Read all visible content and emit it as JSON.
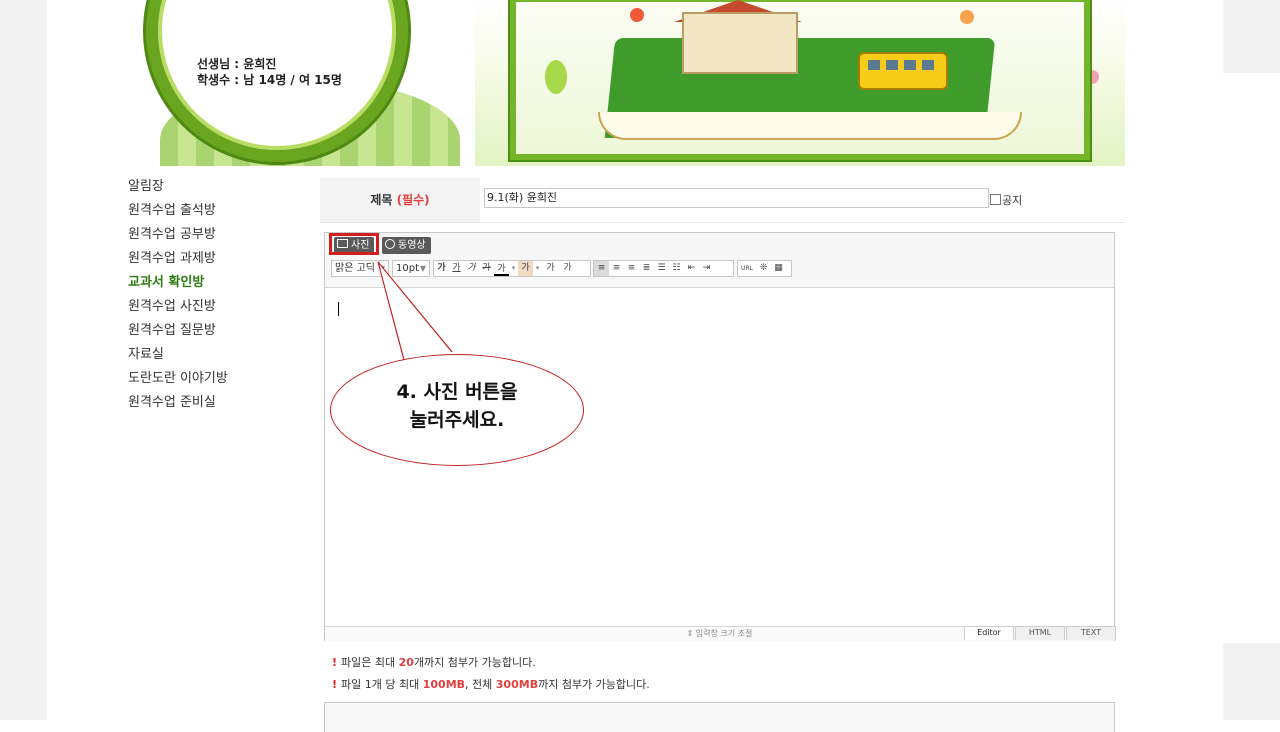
{
  "header": {
    "teacher_line": "선생님 : 윤희진",
    "students_line": "학생수 : 남 14명 / 여 15명"
  },
  "nav": {
    "items": [
      {
        "label": "알림장"
      },
      {
        "label": "원격수업 출석방"
      },
      {
        "label": "원격수업 공부방"
      },
      {
        "label": "원격수업 과제방"
      },
      {
        "label": "교과서 확인방",
        "active": true
      },
      {
        "label": "원격수업 사진방"
      },
      {
        "label": "원격수업 질문방"
      },
      {
        "label": "자료실"
      },
      {
        "label": "도란도란 이야기방"
      },
      {
        "label": "원격수업 준비실"
      }
    ],
    "active_color": "#2e7d12"
  },
  "form": {
    "title_label": "제목",
    "required_label": "(필수)",
    "title_value": "9.1(화) 윤희진",
    "notice_label": "공지"
  },
  "editor": {
    "photo_button": "사진",
    "video_button": "동영상",
    "font_family": "맑은 고딕",
    "font_size": "10pt",
    "format_buttons": [
      "가",
      "가",
      "가",
      "가",
      "가"
    ],
    "color_buttons": [
      "가",
      "가"
    ],
    "script_buttons": [
      "가",
      "가"
    ],
    "url_label": "URL",
    "resize_label": "⇕ 입력창 크기 조절",
    "mode_tabs": [
      "Editor",
      "HTML",
      "TEXT"
    ],
    "active_mode": "Editor"
  },
  "callout": {
    "line1": "4.  사진  버튼을",
    "line2": "눌러주세요.",
    "color": "#c41e1e"
  },
  "info": {
    "line1_pre": "파일은 최대 ",
    "line1_num": "20",
    "line1_post": "개까지 첨부가 가능합니다.",
    "line2_pre": "파일 1개 당 최대 ",
    "line2_num1": "100MB",
    "line2_mid": ", 전체 ",
    "line2_num2": "300MB",
    "line2_post": "까지 첨부가 가능합니다."
  }
}
